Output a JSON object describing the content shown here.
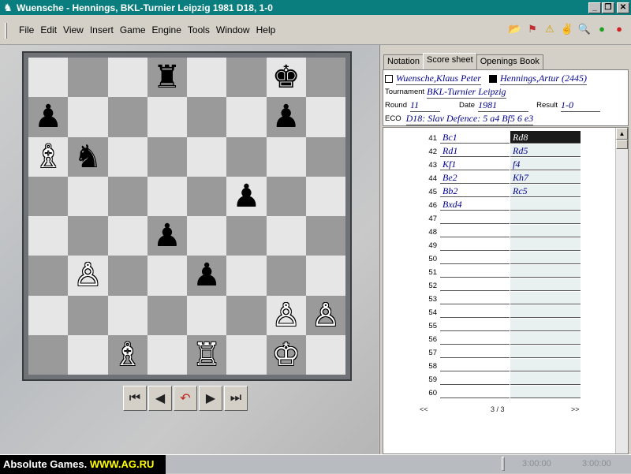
{
  "window": {
    "title": "Wuensche - Hennings, BKL-Turnier Leipzig 1981  D18, 1-0",
    "minimize": "_",
    "restore": "❐",
    "close": "✕"
  },
  "menu": [
    "File",
    "Edit",
    "View",
    "Insert",
    "Game",
    "Engine",
    "Tools",
    "Window",
    "Help"
  ],
  "toolbar_icons": [
    "open-folder-icon",
    "flag-icon",
    "warning-icon",
    "people-icon",
    "search-icon",
    "ok-icon",
    "stop-icon"
  ],
  "toolbar_glyphs": [
    "📂",
    "⚑",
    "⚠",
    "✌",
    "🔍",
    "●",
    "●"
  ],
  "board": {
    "rows": [
      [
        "",
        "",
        "",
        "br",
        "",
        "",
        "bk",
        ""
      ],
      [
        "bp",
        "",
        "",
        "",
        "",
        "",
        "bp",
        ""
      ],
      [
        "wb",
        "bn",
        "",
        "",
        "",
        "",
        "",
        ""
      ],
      [
        "",
        "",
        "",
        "",
        "",
        "bp",
        "",
        ""
      ],
      [
        "",
        "",
        "",
        "bp",
        "",
        "",
        "",
        ""
      ],
      [
        "",
        "wp",
        "",
        "",
        "bp",
        "",
        "",
        ""
      ],
      [
        "",
        "",
        "",
        "",
        "",
        "",
        "wp",
        "wp"
      ],
      [
        "",
        "",
        "wb",
        "",
        "wr",
        "",
        "wk",
        ""
      ]
    ],
    "glyphs": {
      "br": "♜",
      "bk": "♚",
      "bp": "♟",
      "bn": "♞",
      "wb": "♗",
      "wp": "♙",
      "wr": "♖",
      "wk": "♔"
    }
  },
  "nav": {
    "first": "⏮",
    "prev": "◀",
    "undo": "↶",
    "next": "▶",
    "last": "⏭"
  },
  "tabs": [
    {
      "label": "Notation",
      "active": false
    },
    {
      "label": "Score sheet",
      "active": true
    },
    {
      "label": "Openings Book",
      "active": false
    }
  ],
  "game": {
    "white": "Wuensche,Klaus Peter",
    "black": "Hennings,Artur (2445)",
    "tournament_label": "Tournament",
    "tournament": "BKL-Turnier Leipzig",
    "round_label": "Round",
    "round": "11",
    "date_label": "Date",
    "date": "1981",
    "result_label": "Result",
    "result": "1-0",
    "eco_label": "ECO",
    "eco": "D18: Slav Defence: 5 a4 Bf5 6 e3"
  },
  "moves": [
    {
      "n": "41",
      "w": "Bc1",
      "b": "Rd8",
      "selected": true
    },
    {
      "n": "42",
      "w": "Rd1",
      "b": "Rd5"
    },
    {
      "n": "43",
      "w": "Kf1",
      "b": "f4"
    },
    {
      "n": "44",
      "w": "Be2",
      "b": "Kh7"
    },
    {
      "n": "45",
      "w": "Bb2",
      "b": "Rc5"
    },
    {
      "n": "46",
      "w": "Bxd4",
      "b": ""
    },
    {
      "n": "47",
      "w": "",
      "b": ""
    },
    {
      "n": "48",
      "w": "",
      "b": ""
    },
    {
      "n": "49",
      "w": "",
      "b": ""
    },
    {
      "n": "50",
      "w": "",
      "b": ""
    },
    {
      "n": "51",
      "w": "",
      "b": ""
    },
    {
      "n": "52",
      "w": "",
      "b": ""
    },
    {
      "n": "53",
      "w": "",
      "b": ""
    },
    {
      "n": "54",
      "w": "",
      "b": ""
    },
    {
      "n": "55",
      "w": "",
      "b": ""
    },
    {
      "n": "56",
      "w": "",
      "b": ""
    },
    {
      "n": "57",
      "w": "",
      "b": ""
    },
    {
      "n": "58",
      "w": "",
      "b": ""
    },
    {
      "n": "59",
      "w": "",
      "b": ""
    },
    {
      "n": "60",
      "w": "",
      "b": ""
    }
  ],
  "pager": {
    "prev": "<<",
    "page": "3 / 3",
    "next": ">>"
  },
  "status": {
    "brand_prefix": "Absolute Games. ",
    "brand_url": "WWW.AG.RU",
    "clock_white": "3:00:00",
    "clock_black": "3:00:00"
  }
}
